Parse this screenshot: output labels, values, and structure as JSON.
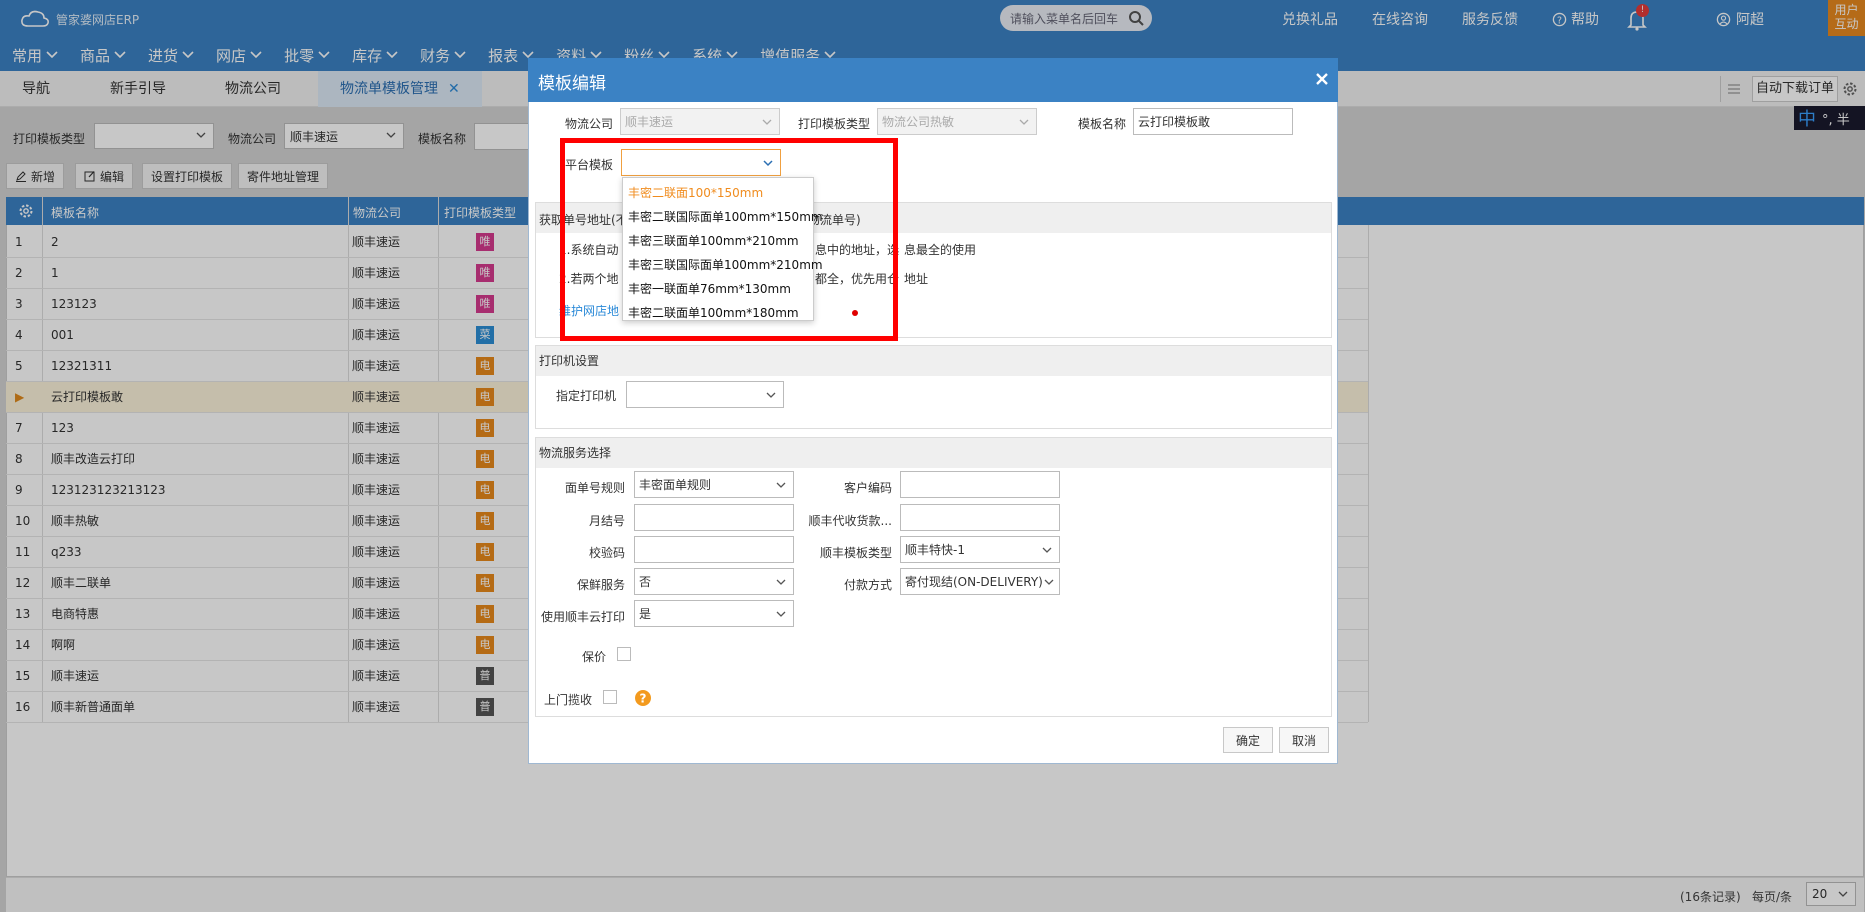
{
  "app": {
    "logo_text": "管家婆网店ERP",
    "search_placeholder": "请输入菜单名后回车",
    "links": [
      "兑换礼品",
      "在线咨询",
      "服务反馈",
      "帮助"
    ],
    "bell_badge": "!",
    "user": "阿超",
    "user_box": [
      "用户",
      "互动"
    ]
  },
  "menu": [
    "常用",
    "商品",
    "进货",
    "网店",
    "批零",
    "库存",
    "财务",
    "报表",
    "资料",
    "粉丝",
    "系统",
    "增值服务"
  ],
  "tabs": [
    "导航",
    "新手引导",
    "物流公司",
    "物流单模板管理"
  ],
  "tab_close": "✕",
  "toolbar_right": {
    "auto_order": "自动下载订单",
    "ime": "中",
    "ime_rest": "°, 半"
  },
  "filters": {
    "type_label": "打印模板类型",
    "type_value": "",
    "company_label": "物流公司",
    "company_value": "顺丰速运",
    "name_label": "模板名称"
  },
  "actions": [
    "新增",
    "编辑",
    "设置打印模板",
    "寄件地址管理"
  ],
  "grid": {
    "headers": [
      "模板名称",
      "物流公司",
      "打印模板类型"
    ],
    "rows": [
      {
        "no": "1",
        "name": "2",
        "company": "顺丰速运",
        "type": "唯",
        "color": "#d63a8f"
      },
      {
        "no": "2",
        "name": "1",
        "company": "顺丰速运",
        "type": "唯",
        "color": "#d63a8f"
      },
      {
        "no": "3",
        "name": "123123",
        "company": "顺丰速运",
        "type": "唯",
        "color": "#d63a8f"
      },
      {
        "no": "4",
        "name": "001",
        "company": "顺丰速运",
        "type": "菜",
        "color": "#2c8fd6"
      },
      {
        "no": "5",
        "name": "12321311",
        "company": "顺丰速运",
        "type": "电",
        "color": "#e8891c"
      },
      {
        "no": "▶",
        "name": "云打印模板敢",
        "company": "顺丰速运",
        "type": "电",
        "color": "#e8891c"
      },
      {
        "no": "7",
        "name": "123",
        "company": "顺丰速运",
        "type": "电",
        "color": "#e8891c"
      },
      {
        "no": "8",
        "name": "顺丰改造云打印",
        "company": "顺丰速运",
        "type": "电",
        "color": "#e8891c"
      },
      {
        "no": "9",
        "name": "123123123213123",
        "company": "顺丰速运",
        "type": "电",
        "color": "#e8891c"
      },
      {
        "no": "10",
        "name": "顺丰热敏",
        "company": "顺丰速运",
        "type": "电",
        "color": "#e8891c"
      },
      {
        "no": "11",
        "name": "q233",
        "company": "顺丰速运",
        "type": "电",
        "color": "#e8891c"
      },
      {
        "no": "12",
        "name": "顺丰二联单",
        "company": "顺丰速运",
        "type": "电",
        "color": "#e8891c"
      },
      {
        "no": "13",
        "name": "电商特惠",
        "company": "顺丰速运",
        "type": "电",
        "color": "#e8891c"
      },
      {
        "no": "14",
        "name": "啊啊",
        "company": "顺丰速运",
        "type": "电",
        "color": "#e8891c"
      },
      {
        "no": "15",
        "name": "顺丰速运",
        "company": "顺丰速运",
        "type": "普",
        "color": "#555555"
      },
      {
        "no": "16",
        "name": "顺丰新普通面单",
        "company": "顺丰速运",
        "type": "普",
        "color": "#555555"
      }
    ]
  },
  "footer": {
    "records": "(16条记录)",
    "per_page_label": "每页/条",
    "per_page": "20"
  },
  "dialog": {
    "title": "模板编辑",
    "company_label": "物流公司",
    "company_value": "顺丰速运",
    "print_type_label": "打印模板类型",
    "print_type_value": "物流公司热敏",
    "name_label": "模板名称",
    "name_value": "云打印模板敢",
    "platform_label": "平台模板",
    "platform_value": "",
    "dropdown_options": [
      "丰密二联面100*150mm",
      "丰密二联国际面单100mm*150mm",
      "丰密三联面单100mm*210mm",
      "丰密三联国际面单100mm*210mm",
      "丰密一联面单76mm*130mm",
      "丰密二联面单100mm*180mm"
    ],
    "addr_title_a": "获取单号地址(不",
    "addr_title_b": "物流单号)",
    "addr_line1_a": "1.系统自动",
    "addr_line1_b": "息中的地址，选",
    "addr_line1_c": "息最全的使用",
    "addr_line2_a": "2.若两个地",
    "addr_line2_b": "都全，优先用仓",
    "addr_line2_c": "地址",
    "addr_link": "维护网店地",
    "printer_title": "打印机设置",
    "printer_label": "指定打印机",
    "printer_value": "",
    "service_title": "物流服务选择",
    "fields": {
      "rule_label": "面单号规则",
      "rule_value": "丰密面单规则",
      "customer_code_label": "客户编码",
      "customer_code_value": "",
      "monthly_label": "月结号",
      "monthly_value": "",
      "cod_label": "顺丰代收货款...",
      "cod_value": "",
      "check_label": "校验码",
      "check_value": "",
      "sf_type_label": "顺丰模板类型",
      "sf_type_value": "顺丰特快-1",
      "fresh_label": "保鲜服务",
      "fresh_value": "否",
      "pay_label": "付款方式",
      "pay_value": "寄付现结(ON-DELIVERY)",
      "cloud_label": "使用顺丰云打印",
      "cloud_value": "是",
      "insure_label": "保价",
      "pickup_label": "上门揽收"
    },
    "ok": "确定",
    "cancel": "取消"
  },
  "colors": {
    "primary": "#3b82c4",
    "highlight": "#ff0000",
    "selected_option": "#f08c1e"
  }
}
